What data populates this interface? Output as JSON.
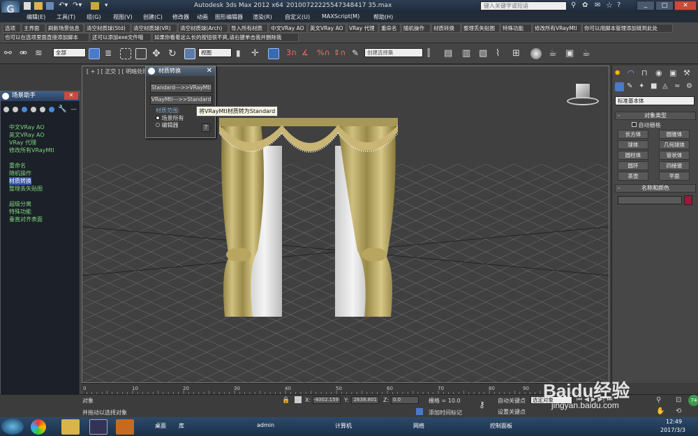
{
  "titlebar": {
    "app_title": "Autodesk 3ds Max  2012 x64",
    "file_name": "20100722225547348417 35.max",
    "search_placeholder": "键入关键字或短语"
  },
  "menus": [
    "编辑(E)",
    "工具(T)",
    "组(G)",
    "视图(V)",
    "创建(C)",
    "修改器",
    "动画",
    "图形编辑器",
    "渲染(R)",
    "自定义(U)",
    "MAXScript(M)",
    "帮助(H)"
  ],
  "script_row1": [
    "选项",
    "主界面",
    "刷新场景信息",
    "清空材质球(Std)",
    "清空材质球(VR)",
    "清空材质球(Arch)",
    "导入所有材质",
    "中文VRay AO",
    "英文VRay AO",
    "VRay 代理",
    "重命名",
    "随机操作",
    "材质转换",
    "整理丢失贴图",
    "特殊功能",
    "修改所有VRayMtl",
    "你可以用脚本管理添加链到此处"
  ],
  "script_row2": [
    "也可以在选项里面直接添加脚本",
    "还可以添加exe文件哦",
    "如果你看着这么长的按钮很不爽,请右键单击我并删除我"
  ],
  "toolbar": {
    "filter_value": "全部",
    "refcoord_value": "视图",
    "selset_placeholder": "创建选择集"
  },
  "viewport": {
    "label": "[ + ] [ 正交 ] [ 明暗处理 ]"
  },
  "scene_helper": {
    "title": "场景助手",
    "items": [
      "中文VRay AO",
      "英文VRay AO",
      "VRay 代理",
      "修改所有VRayMtl",
      "重命名",
      "随机操作",
      "材质转换",
      "整理丢失贴图",
      "超级分离",
      "特殊功能",
      "垂直对齐表面"
    ]
  },
  "material_converter": {
    "title": "材质转换",
    "btn_to_vray": "Standard--->>VRayMtl",
    "btn_to_std": "VRayMtl--->>Standard",
    "range_label": "材质范围:",
    "opt_scene": "场景所有",
    "opt_editor": "编辑器",
    "help": "?",
    "tooltip": "将VRayMtl材质转为Standard"
  },
  "command_panel": {
    "dropdown": "标准基本体",
    "rollout_type": "对象类型",
    "autogrid": "自动栅格",
    "objects": [
      "长方体",
      "圆锥体",
      "球体",
      "几何球体",
      "圆柱体",
      "管状体",
      "圆环",
      "四棱锥",
      "茶壶",
      "平面"
    ],
    "rollout_name": "名称和颜色",
    "color": "#9a1a3a"
  },
  "timeline": {
    "ticks": [
      "0",
      "10",
      "20",
      "30",
      "40",
      "50",
      "60",
      "70",
      "80",
      "90"
    ]
  },
  "status": {
    "line1": "对象",
    "line2": "并拖动以选择对象",
    "x_label": "X:",
    "x_val": "-4002.159",
    "y_label": "Y:",
    "y_val": "2638.801",
    "z_label": "Z:",
    "z_val": "0.0",
    "grid": "栅格 = 10.0",
    "add_time_tag": "添加时间标记",
    "autokey": "自动关键点",
    "setkey": "设置关键点",
    "sel_value": "选定对象",
    "badge": "74"
  },
  "taskbar": {
    "items": [
      "桌面",
      "库",
      "admin",
      "计算机",
      "网络",
      "控制面板"
    ],
    "time": "12:49",
    "date": "2017/3/3"
  },
  "watermark": {
    "text": "Baidu经验",
    "url": "jingyan.baidu.com"
  }
}
